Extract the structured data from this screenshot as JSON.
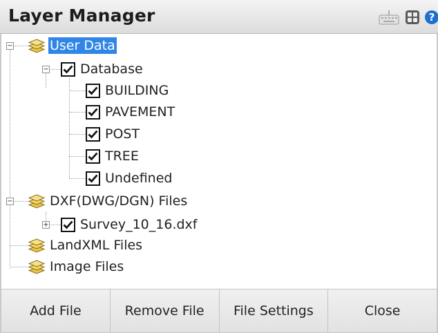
{
  "window": {
    "title": "Layer Manager",
    "toolbar_icons": [
      "keyboard-icon",
      "calculator-icon",
      "help-icon"
    ]
  },
  "tree": {
    "user_data": {
      "label": "User Data",
      "selected": true,
      "expanded": true,
      "database": {
        "label": "Database",
        "checked": true,
        "expanded": true,
        "layers": [
          {
            "label": "BUILDING",
            "checked": true
          },
          {
            "label": "PAVEMENT",
            "checked": true
          },
          {
            "label": "POST",
            "checked": true
          },
          {
            "label": "TREE",
            "checked": true
          },
          {
            "label": "Undefined",
            "checked": true
          }
        ]
      }
    },
    "dxf_files": {
      "label": "DXF(DWG/DGN) Files",
      "expanded": true,
      "files": [
        {
          "label": "Survey_10_16.dxf",
          "checked": true,
          "expanded": false
        }
      ]
    },
    "landxml_files": {
      "label": "LandXML Files"
    },
    "image_files": {
      "label": "Image Files"
    }
  },
  "buttons": {
    "add_file": "Add File",
    "remove_file": "Remove File",
    "file_settings": "File Settings",
    "close": "Close"
  },
  "colors": {
    "selection": "#2f86e6",
    "layer_icon": "#e8c64a",
    "help_icon": "#1f6fcf"
  }
}
